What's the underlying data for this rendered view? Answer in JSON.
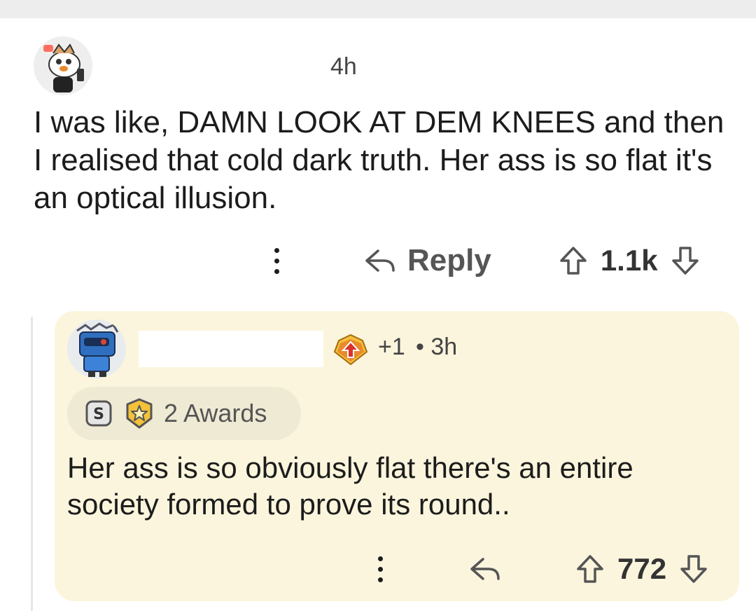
{
  "parent_comment": {
    "timestamp": "4h",
    "body": "I was like, DAMN LOOK AT DEM KNEES and then I realised that cold dark truth. Her ass is so flat it's an optical illusion.",
    "reply_label": "Reply",
    "vote_count": "1.1k"
  },
  "child_comment": {
    "karma_badge": "+1",
    "timestamp": "• 3h",
    "awards_label": "2 Awards",
    "body": "Her ass is so obviously flat there's an entire society formed to prove its round..",
    "vote_count": "772"
  },
  "colors": {
    "card_background": "#fbf5dd",
    "awards_pill": "#efead4",
    "flair_orange": "#e98a2c",
    "award_gold": "#f3c13a"
  },
  "icons": {
    "more": "kebab-menu-icon",
    "reply": "reply-arrow-icon",
    "upvote": "upvote-arrow-icon",
    "downvote": "downvote-arrow-icon",
    "silver_award": "silver-award-icon",
    "gold_award": "gold-award-icon",
    "flair": "upvote-flair-icon"
  }
}
